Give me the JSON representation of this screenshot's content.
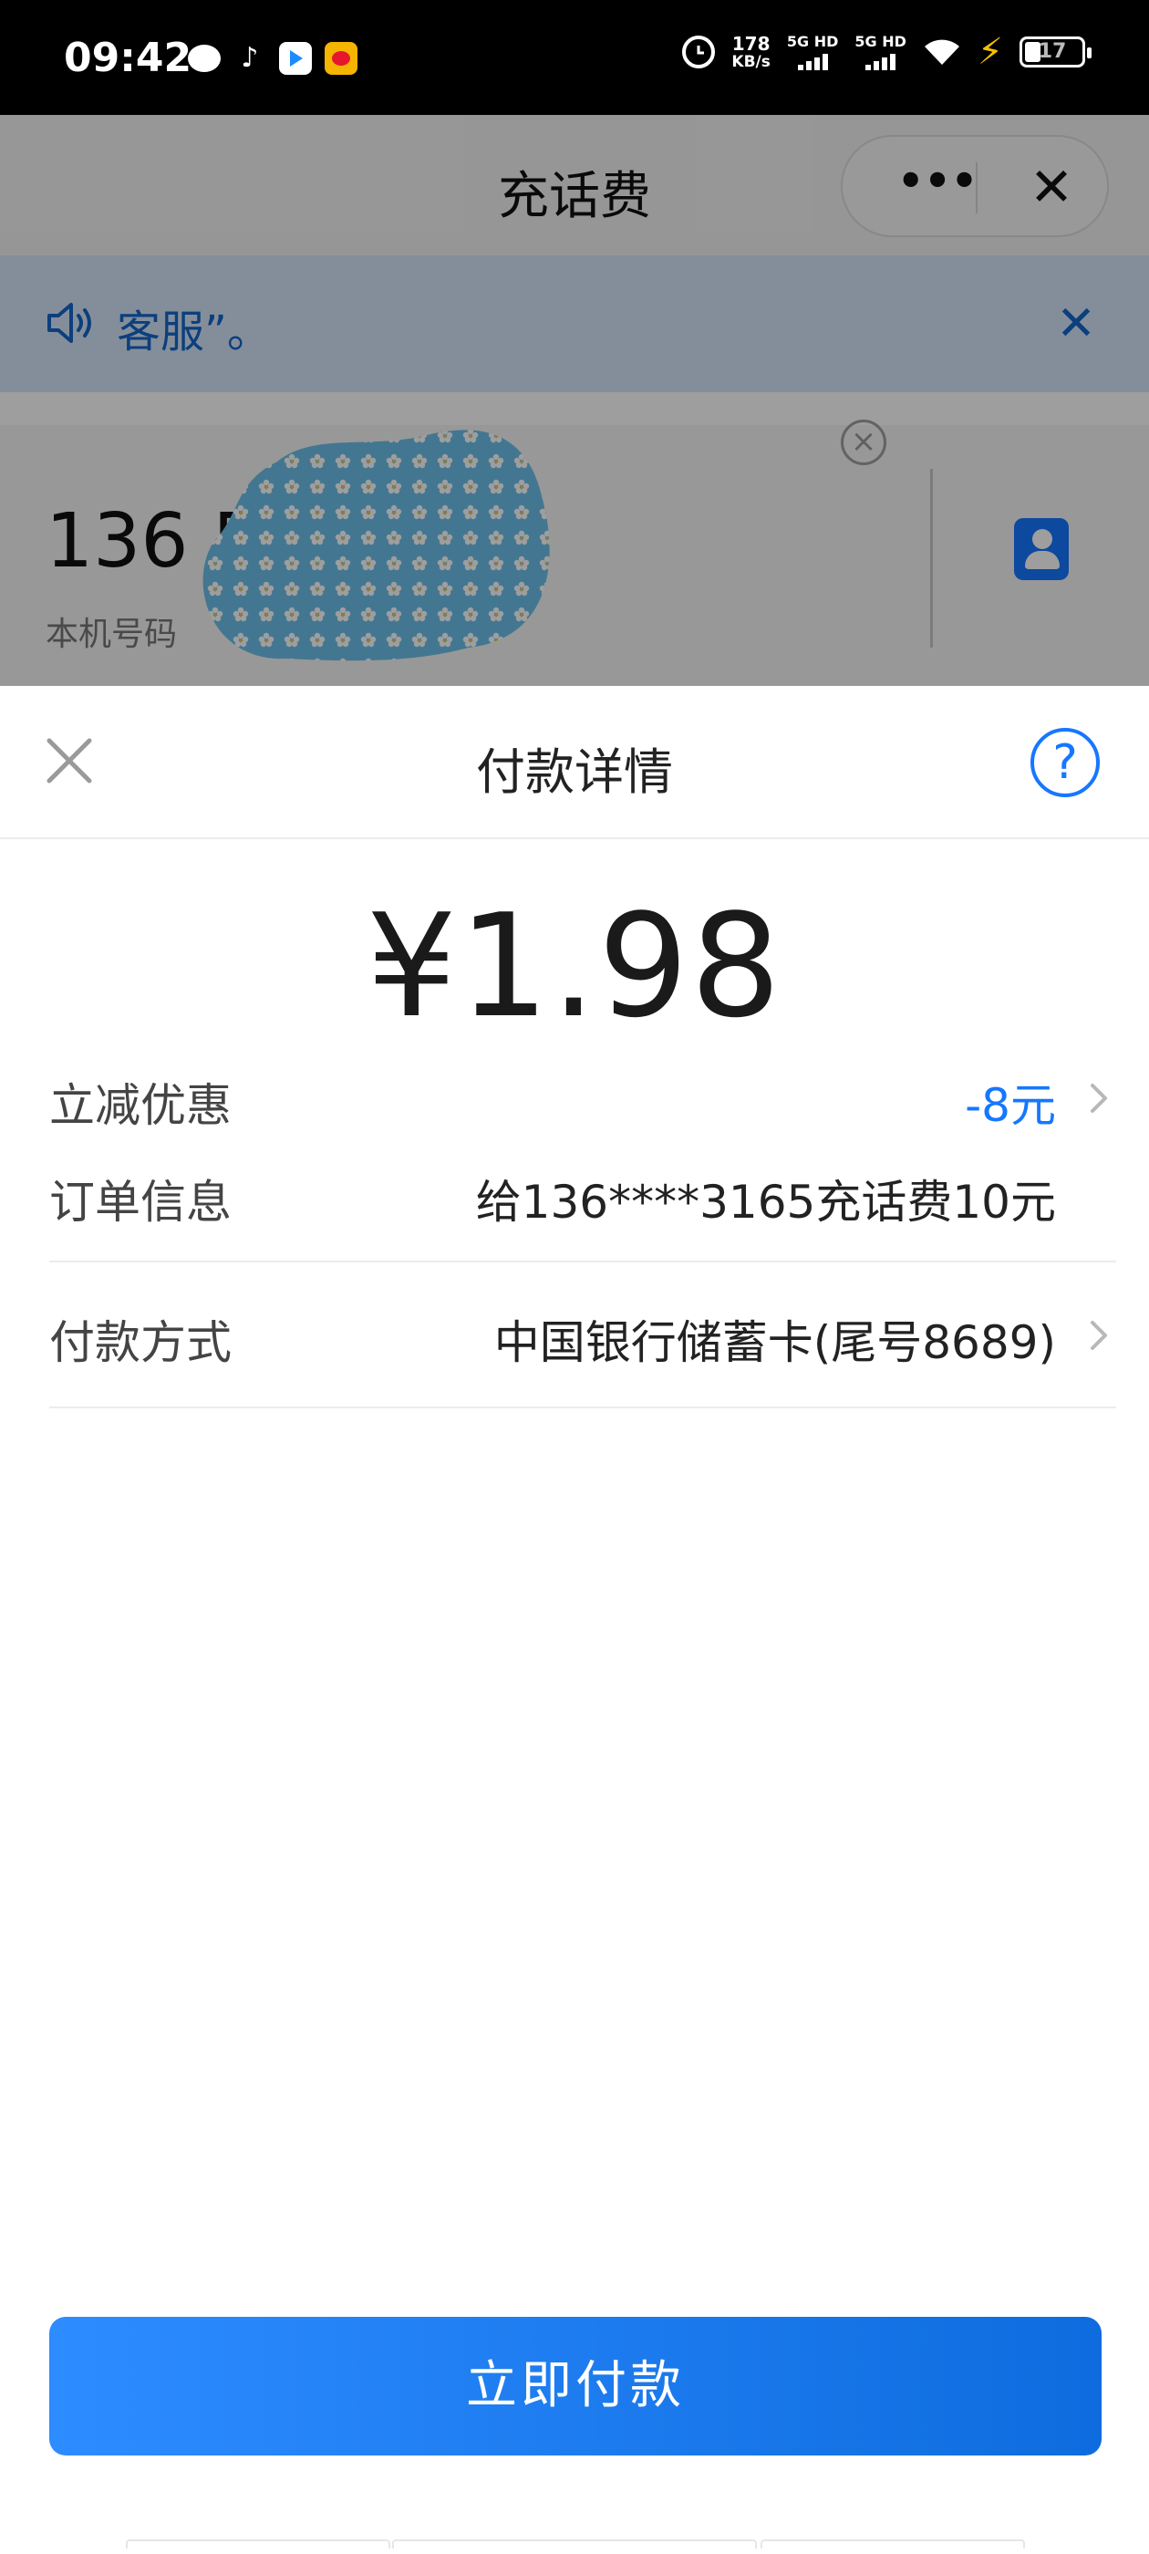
{
  "status_bar": {
    "time": "09:42",
    "net_speed_value": "178",
    "net_speed_unit": "KB/s",
    "sim1_label": "5G HD",
    "sim2_label": "5G HD",
    "battery_level": "17",
    "icons": [
      "message-icon",
      "tiktok-icon",
      "video-app-icon",
      "weibo-icon",
      "alarm-icon",
      "signal-icon",
      "wifi-icon",
      "charging-icon",
      "battery-icon"
    ]
  },
  "background_page": {
    "title": "充话费",
    "more_glyph": "•••",
    "close_glyph": "✕",
    "notice": {
      "text": "客服”。",
      "close_glyph": "✕"
    },
    "phone": {
      "number": "136 5",
      "label": "本机号码"
    }
  },
  "payment_sheet": {
    "title": "付款详情",
    "help_glyph": "?",
    "amount": "¥1.98",
    "rows": [
      {
        "label": "立减优惠",
        "value": "-8元"
      },
      {
        "label": "订单信息",
        "value": "给136****3165充话费10元"
      },
      {
        "label": "付款方式",
        "value": "中国银行储蓄卡(尾号8689)"
      }
    ],
    "pay_button": "立即付款"
  },
  "colors": {
    "accent": "#1677ff",
    "notice_bg": "#d5e6fb",
    "overlay": "rgba(0,0,0,0.38)"
  }
}
